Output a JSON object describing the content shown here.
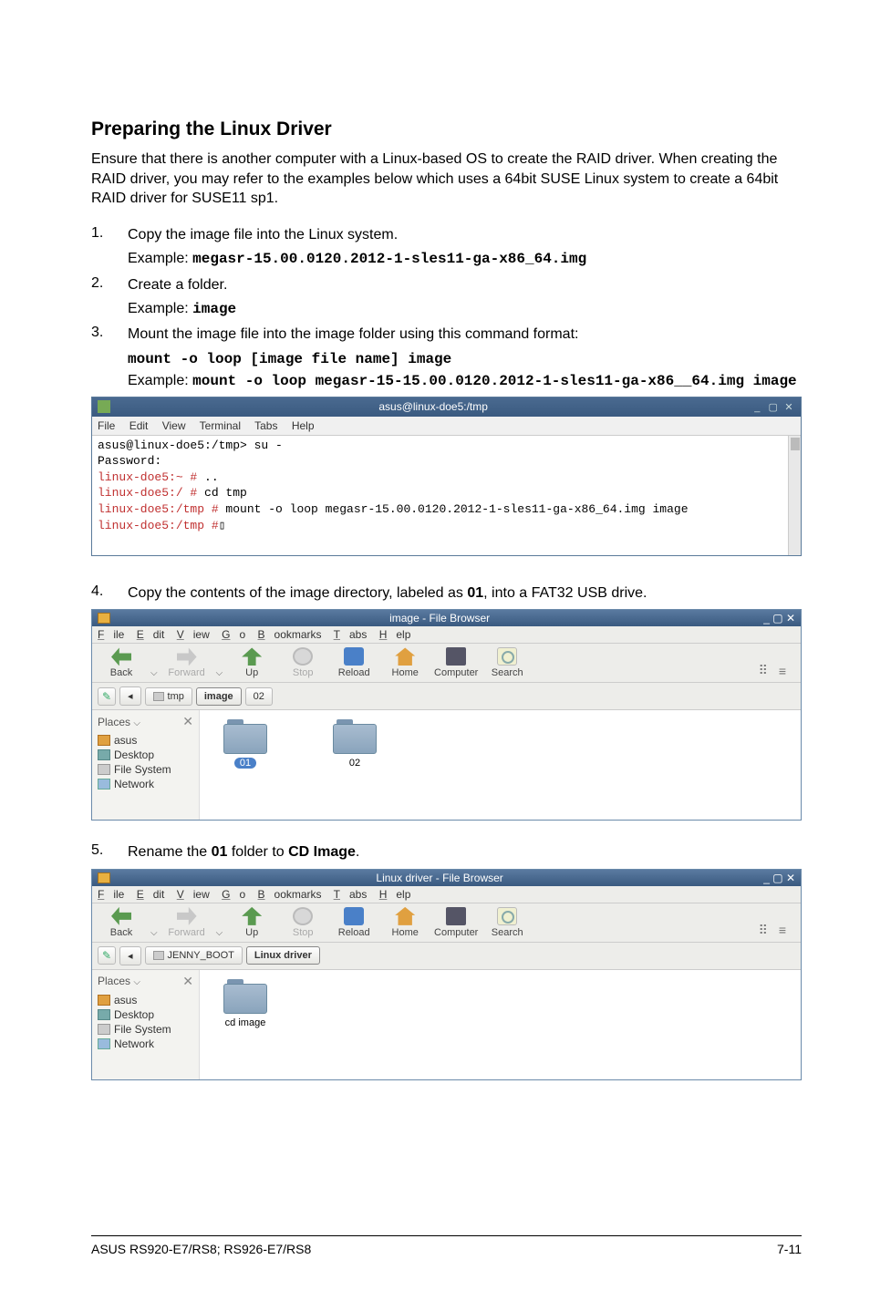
{
  "heading": "Preparing the Linux Driver",
  "intro": "Ensure that there is another computer with a Linux-based OS to create the RAID driver. When creating the RAID driver, you may refer to the examples below which uses a 64bit SUSE Linux system to create a 64bit RAID driver for SUSE11 sp1.",
  "steps": {
    "s1_num": "1.",
    "s1_text": "Copy the image file into the Linux system.",
    "s1_ex_label": "Example: ",
    "s1_ex_code": "megasr-15.00.0120.2012-1-sles11-ga-x86_64.img",
    "s2_num": "2.",
    "s2_text": "Create a folder.",
    "s2_ex_label": "Example: ",
    "s2_ex_code": "image",
    "s3_num": "3.",
    "s3_text": "Mount the image file into the image folder using this command format:",
    "s3_code": "mount -o loop [image file name] image",
    "s3_ex_label": "Example: ",
    "s3_ex_code": "mount -o loop megasr-15-15.00.0120.2012-1-sles11-ga-x86__64.img image",
    "s4_num": "4.",
    "s4_text_a": "Copy the contents of the image directory, labeled as ",
    "s4_bold": "01",
    "s4_text_b": ", into  a FAT32 USB drive.",
    "s5_num": "5.",
    "s5_text_a": "Rename the ",
    "s5_bold1": "01",
    "s5_text_b": " folder to ",
    "s5_bold2": "CD Image",
    "s5_text_c": "."
  },
  "terminal": {
    "title": "asus@linux-doe5:/tmp",
    "menu": {
      "file": "File",
      "edit": "Edit",
      "view": "View",
      "terminal": "Terminal",
      "tabs": "Tabs",
      "help": "Help"
    },
    "lines": {
      "l1": "asus@linux-doe5:/tmp> su -",
      "l2": "Password:",
      "l3a": "linux-doe5:~ #",
      "l3b": " ..",
      "l4a": "linux-doe5:/ #",
      "l4b": " cd tmp",
      "l5a": "linux-doe5:/tmp #",
      "l5b": " mount -o loop megasr-15.00.0120.2012-1-sles11-ga-x86_64.img image",
      "l6a": "linux-doe5:/tmp #",
      "l6b": " "
    }
  },
  "fb_menu": {
    "file": "File",
    "edit": "Edit",
    "view": "View",
    "go": "Go",
    "bookmarks": "Bookmarks",
    "tabs": "Tabs",
    "help": "Help"
  },
  "fb_toolbar": {
    "back": "Back",
    "forward": "Forward",
    "up": "Up",
    "stop": "Stop",
    "reload": "Reload",
    "home": "Home",
    "computer": "Computer",
    "search": "Search"
  },
  "fb_sidebar": {
    "places": "Places",
    "asus": "asus",
    "desktop": "Desktop",
    "filesystem": "File System",
    "network": "Network"
  },
  "fb1": {
    "title": "image - File Browser",
    "path": {
      "p1": "tmp",
      "p2": "image",
      "p3": "02"
    },
    "folders": {
      "f1": "01",
      "f2": "02"
    }
  },
  "fb2": {
    "title": "Linux driver - File Browser",
    "path": {
      "p1": "JENNY_BOOT",
      "p2": "Linux driver"
    },
    "folders": {
      "f1": "cd image"
    }
  },
  "footer": {
    "left": "ASUS RS920-E7/RS8; RS926-E7/RS8",
    "right": "7-11"
  }
}
